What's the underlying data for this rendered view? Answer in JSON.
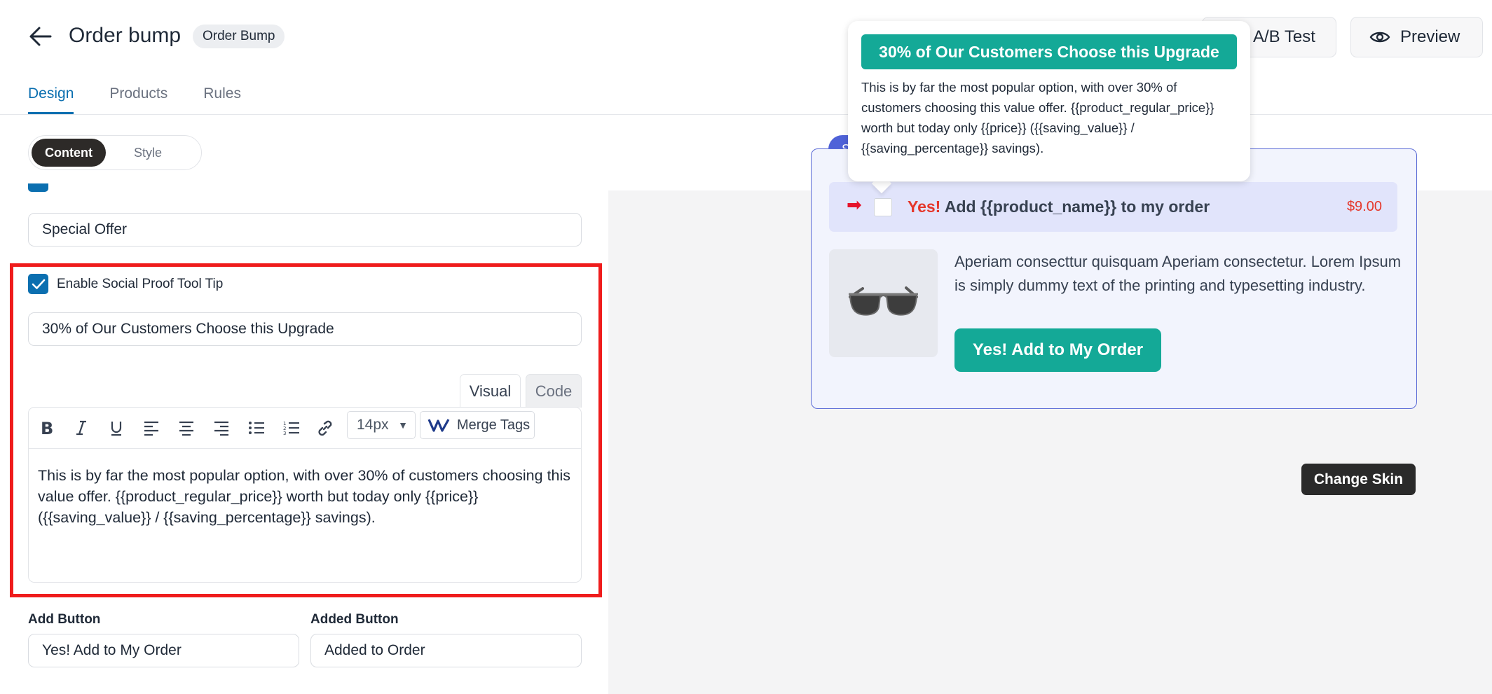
{
  "header": {
    "title": "Order bump",
    "badge": "Order Bump",
    "ab_test_label": "A/B Test",
    "preview_label": "Preview"
  },
  "tabs": [
    {
      "label": "Design",
      "active": true
    },
    {
      "label": "Products",
      "active": false
    },
    {
      "label": "Rules",
      "active": false
    }
  ],
  "segment": {
    "content": "Content",
    "style": "Style",
    "selected": "Content"
  },
  "form": {
    "header_text_value": "Special Offer",
    "social_proof_checkbox_label": "Enable Social Proof Tool Tip",
    "social_proof_checked": true,
    "tooltip_heading_value": "30% of Our Customers Choose this Upgrade",
    "editor": {
      "tab_visual": "Visual",
      "tab_code": "Code",
      "font_size": "14px",
      "merge_tags_label": "Merge Tags",
      "body": "This is by far the most popular option, with over 30% of customers choosing this value offer. {{product_regular_price}} worth but today only {{price}} ({{saving_value}} / {{saving_percentage}} savings)."
    },
    "add_button_label": "Add Button",
    "add_button_value": "Yes! Add to My Order",
    "added_button_label": "Added Button",
    "added_button_value": "Added to Order"
  },
  "preview": {
    "card_tag": "S",
    "bump_yes": "Yes!",
    "bump_text": " Add {{product_name}} to my order",
    "price": "$9.00",
    "description": "Aperiam consecttur quisquam Aperiam consectetur. Lorem Ipsum is simply dummy text of the printing and typesetting industry.",
    "cta": "Yes! Add to My Order",
    "change_skin": "Change Skin"
  },
  "tooltip": {
    "heading": "30% of Our Customers Choose this Upgrade",
    "body": "This is by far the most popular option, with over 30% of customers choosing this value offer. {{product_regular_price}} worth but today only {{price}} ({{saving_value}} / {{saving_percentage}} savings)."
  },
  "colors": {
    "accent_blue": "#0b6fb0",
    "teal": "#14a997",
    "highlight_red": "#ef1c1c",
    "price_red": "#e5372b"
  }
}
